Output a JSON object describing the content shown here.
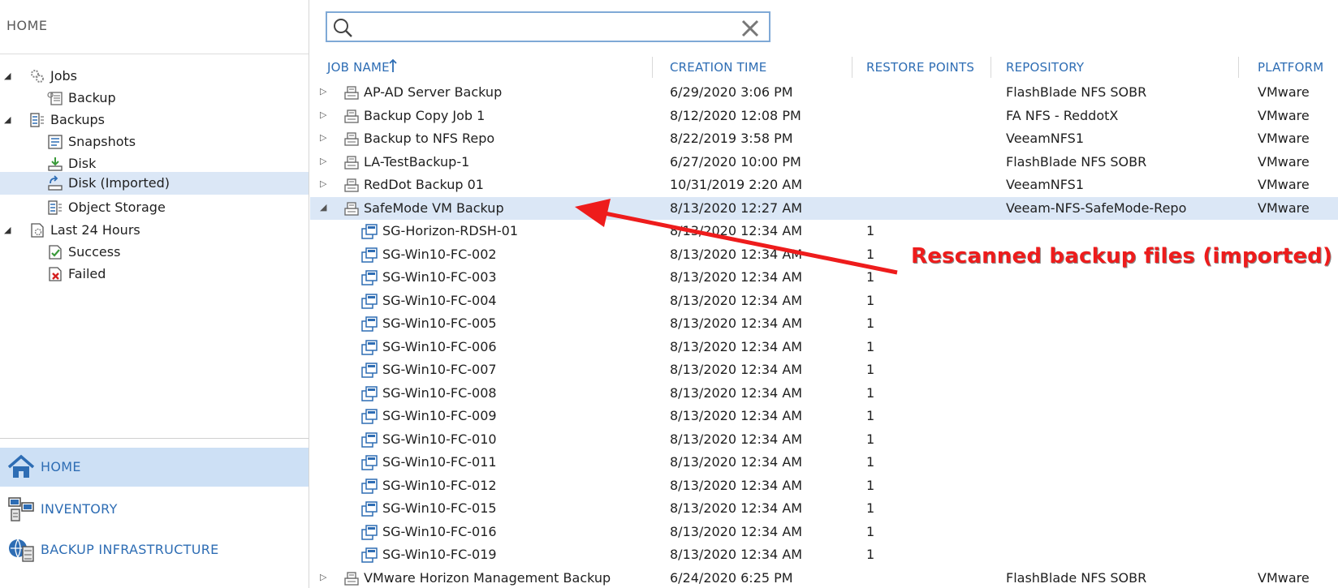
{
  "sidebar": {
    "title": "HOME",
    "tree": [
      {
        "label": "Jobs",
        "icon": "jobs-gear-icon",
        "caret": "expanded"
      },
      {
        "label": "Backup",
        "icon": "backup-job-icon",
        "caret": ""
      },
      {
        "label": "Backups",
        "icon": "backups-icon",
        "caret": "expanded"
      },
      {
        "label": "Snapshots",
        "icon": "snapshots-icon",
        "caret": ""
      },
      {
        "label": "Disk",
        "icon": "disk-icon",
        "caret": ""
      },
      {
        "label": "Disk (Imported)",
        "icon": "disk-imported-icon",
        "caret": "",
        "selected": true
      },
      {
        "label": "Object Storage",
        "icon": "object-storage-icon",
        "caret": ""
      },
      {
        "label": "Last 24 Hours",
        "icon": "last-24-hours-icon",
        "caret": "expanded"
      },
      {
        "label": "Success",
        "icon": "success-icon",
        "caret": ""
      },
      {
        "label": "Failed",
        "icon": "failed-icon",
        "caret": ""
      }
    ],
    "nav": [
      {
        "label": "HOME",
        "icon": "home-icon",
        "active": true
      },
      {
        "label": "INVENTORY",
        "icon": "inventory-icon"
      },
      {
        "label": "BACKUP INFRASTRUCTURE",
        "icon": "backup-infrastructure-icon"
      }
    ]
  },
  "search": {
    "value": "",
    "placeholder": ""
  },
  "columns": {
    "job_name": "JOB NAME",
    "creation_time": "CREATION TIME",
    "restore_points": "RESTORE POINTS",
    "repository": "REPOSITORY",
    "platform": "PLATFORM"
  },
  "rows": [
    {
      "name": "AP-AD Server Backup",
      "time": "6/29/2020 3:06 PM",
      "points": "",
      "repo": "FlashBlade NFS SOBR",
      "platform": "VMware",
      "level": 0,
      "caret": "collapsed"
    },
    {
      "name": "Backup Copy Job 1",
      "time": "8/12/2020 12:08 PM",
      "points": "",
      "repo": "FA NFS - ReddotX",
      "platform": "VMware",
      "level": 0,
      "caret": "collapsed"
    },
    {
      "name": "Backup to NFS Repo",
      "time": "8/22/2019 3:58 PM",
      "points": "",
      "repo": "VeeamNFS1",
      "platform": "VMware",
      "level": 0,
      "caret": "collapsed"
    },
    {
      "name": "LA-TestBackup-1",
      "time": "6/27/2020 10:00 PM",
      "points": "",
      "repo": "FlashBlade NFS SOBR",
      "platform": "VMware",
      "level": 0,
      "caret": "collapsed"
    },
    {
      "name": "RedDot Backup 01",
      "time": "10/31/2019 2:20 AM",
      "points": "",
      "repo": "VeeamNFS1",
      "platform": "VMware",
      "level": 0,
      "caret": "collapsed"
    },
    {
      "name": "SafeMode VM Backup",
      "time": "8/13/2020 12:27 AM",
      "points": "",
      "repo": "Veeam-NFS-SafeMode-Repo",
      "platform": "VMware",
      "level": 0,
      "caret": "expanded",
      "selected": true
    },
    {
      "name": "SG-Horizon-RDSH-01",
      "time": "8/13/2020 12:34 AM",
      "points": "1",
      "repo": "",
      "platform": "",
      "level": 1
    },
    {
      "name": "SG-Win10-FC-002",
      "time": "8/13/2020 12:34 AM",
      "points": "1",
      "repo": "",
      "platform": "",
      "level": 1
    },
    {
      "name": "SG-Win10-FC-003",
      "time": "8/13/2020 12:34 AM",
      "points": "1",
      "repo": "",
      "platform": "",
      "level": 1
    },
    {
      "name": "SG-Win10-FC-004",
      "time": "8/13/2020 12:34 AM",
      "points": "1",
      "repo": "",
      "platform": "",
      "level": 1
    },
    {
      "name": "SG-Win10-FC-005",
      "time": "8/13/2020 12:34 AM",
      "points": "1",
      "repo": "",
      "platform": "",
      "level": 1
    },
    {
      "name": "SG-Win10-FC-006",
      "time": "8/13/2020 12:34 AM",
      "points": "1",
      "repo": "",
      "platform": "",
      "level": 1
    },
    {
      "name": "SG-Win10-FC-007",
      "time": "8/13/2020 12:34 AM",
      "points": "1",
      "repo": "",
      "platform": "",
      "level": 1
    },
    {
      "name": "SG-Win10-FC-008",
      "time": "8/13/2020 12:34 AM",
      "points": "1",
      "repo": "",
      "platform": "",
      "level": 1
    },
    {
      "name": "SG-Win10-FC-009",
      "time": "8/13/2020 12:34 AM",
      "points": "1",
      "repo": "",
      "platform": "",
      "level": 1
    },
    {
      "name": "SG-Win10-FC-010",
      "time": "8/13/2020 12:34 AM",
      "points": "1",
      "repo": "",
      "platform": "",
      "level": 1
    },
    {
      "name": "SG-Win10-FC-011",
      "time": "8/13/2020 12:34 AM",
      "points": "1",
      "repo": "",
      "platform": "",
      "level": 1
    },
    {
      "name": "SG-Win10-FC-012",
      "time": "8/13/2020 12:34 AM",
      "points": "1",
      "repo": "",
      "platform": "",
      "level": 1
    },
    {
      "name": "SG-Win10-FC-015",
      "time": "8/13/2020 12:34 AM",
      "points": "1",
      "repo": "",
      "platform": "",
      "level": 1
    },
    {
      "name": "SG-Win10-FC-016",
      "time": "8/13/2020 12:34 AM",
      "points": "1",
      "repo": "",
      "platform": "",
      "level": 1
    },
    {
      "name": "SG-Win10-FC-019",
      "time": "8/13/2020 12:34 AM",
      "points": "1",
      "repo": "",
      "platform": "",
      "level": 1
    },
    {
      "name": "VMware Horizon Management Backup",
      "time": "6/24/2020 6:25 PM",
      "points": "",
      "repo": "FlashBlade NFS SOBR",
      "platform": "VMware",
      "level": 0,
      "caret": "collapsed"
    }
  ],
  "annotation": {
    "text": "Rescanned backup files (imported)",
    "color": "#ee1c1c"
  },
  "colors": {
    "accent": "#2e6db4",
    "selection": "#dbe7f6",
    "nav_active": "#cde0f5"
  }
}
